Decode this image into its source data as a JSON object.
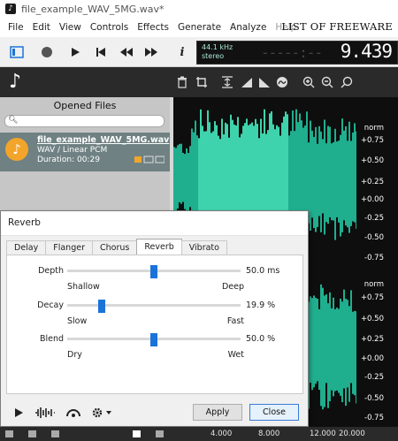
{
  "window": {
    "title": "file_example_WAV_5MG.wav*"
  },
  "menu": {
    "items": [
      "File",
      "Edit",
      "View",
      "Controls",
      "Effects",
      "Generate",
      "Analyze",
      "Help"
    ],
    "brand": "LIST OF FREEWARE"
  },
  "display": {
    "rate": "44.1 kHz",
    "mode": "stereo",
    "dashes": "-----:--",
    "time": "9.439"
  },
  "left_panel": {
    "title": "Opened Files",
    "file": {
      "name": "file_example_WAV_5MG.wav",
      "format": "WAV / Linear PCM",
      "duration": "Duration: 00:29"
    }
  },
  "ruler": {
    "labels": [
      "norm",
      "+0.75",
      "+0.50",
      "+0.25",
      "+0.00",
      "-0.25",
      "-0.50",
      "-0.75",
      "norm",
      "+0.75",
      "+0.50",
      "+0.25",
      "+0.00",
      "-0.25",
      "-0.50",
      "-0.75"
    ]
  },
  "dialog": {
    "title": "Reverb",
    "tabs": [
      "Delay",
      "Flanger",
      "Chorus",
      "Reverb",
      "Vibrato"
    ],
    "active_tab": "Reverb",
    "params": [
      {
        "label": "Depth",
        "value": "50.0 ms",
        "low": "Shallow",
        "high": "Deep",
        "level": 0.5
      },
      {
        "label": "Decay",
        "value": "19.9 %",
        "low": "Slow",
        "high": "Fast",
        "level": 0.2
      },
      {
        "label": "Blend",
        "value": "50.0 %",
        "low": "Dry",
        "high": "Wet",
        "level": 0.5
      }
    ],
    "apply": "Apply",
    "close": "Close"
  },
  "timeline": {
    "labels": [
      "4.000",
      "8.000",
      "12.000",
      "20.000"
    ]
  },
  "colors": {
    "wave": "#1fae8e",
    "wave_selected": "#3ed3ac",
    "slider": "#1a73d9"
  }
}
